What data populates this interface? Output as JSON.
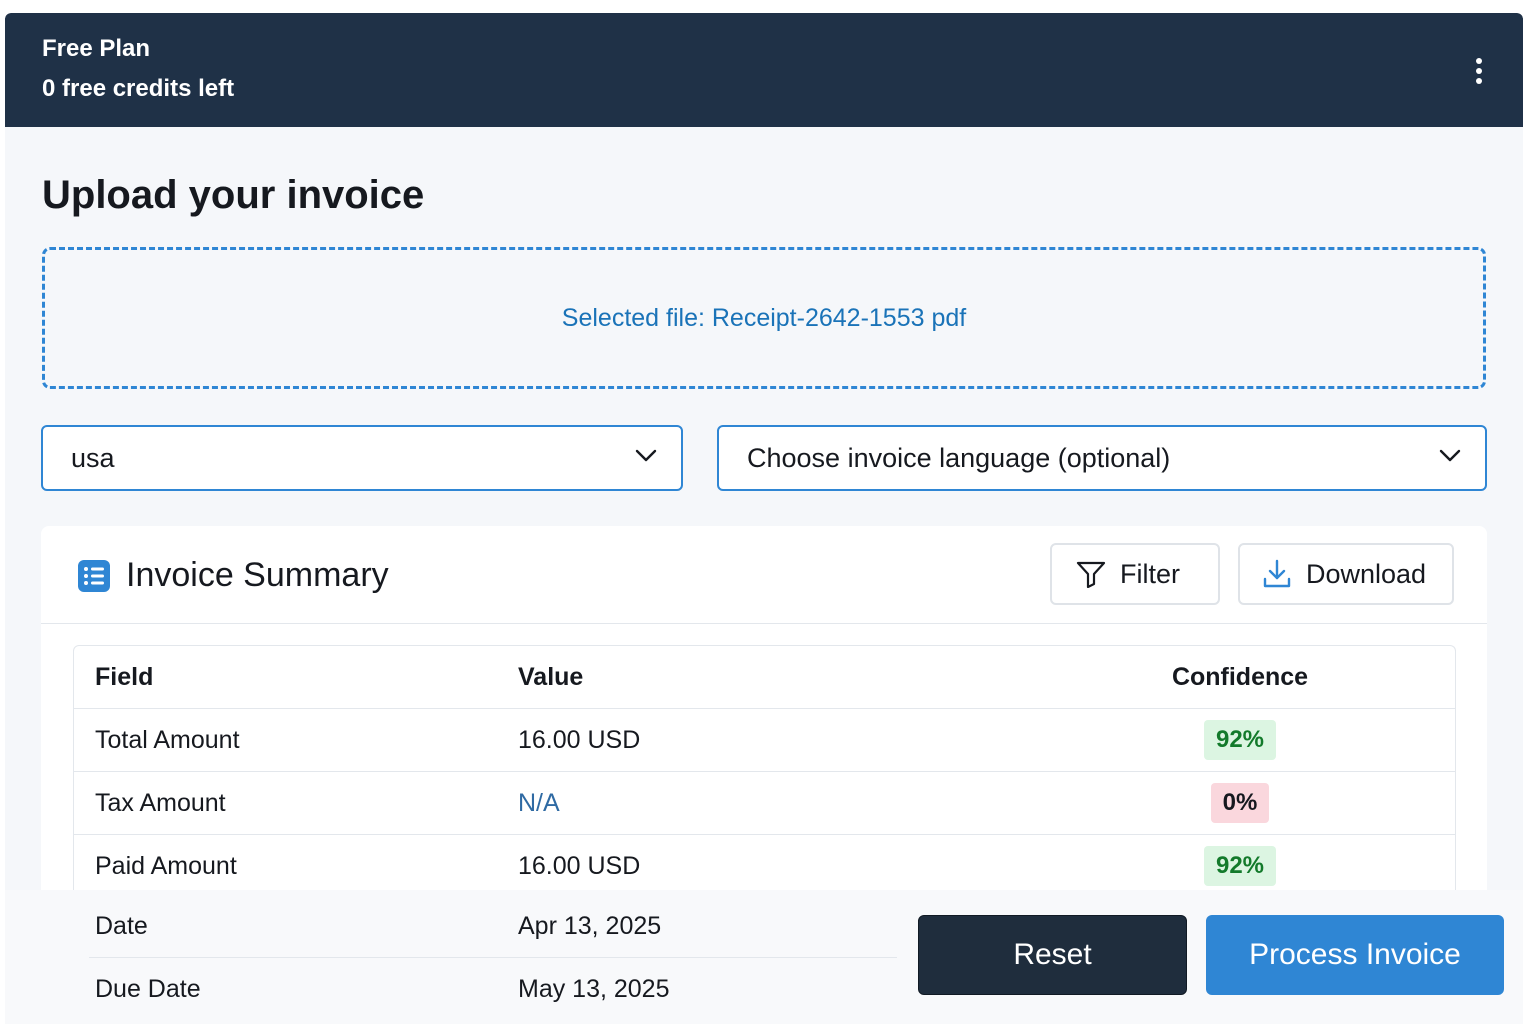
{
  "header": {
    "plan_name": "Free Plan",
    "credits_text": "0 free credits left",
    "menu_icon": "more-vertical-icon"
  },
  "page": {
    "title": "Upload your invoice"
  },
  "upload": {
    "selected_file_text": "Selected file: Receipt-2642-1553 pdf"
  },
  "selects": {
    "country_value": "usa",
    "language_placeholder": "Choose invoice language (optional)",
    "chevron_icon": "chevron-down-icon"
  },
  "summary": {
    "title": "Invoice Summary",
    "icon": "list-icon",
    "filter_label": "Filter",
    "filter_icon": "filter-icon",
    "download_label": "Download",
    "download_icon": "download-icon",
    "columns": [
      "Field",
      "Value",
      "Confidence"
    ],
    "rows": [
      {
        "field": "Total Amount",
        "value": "16.00 USD",
        "confidence": "92%"
      },
      {
        "field": "Tax Amount",
        "value": "N/A",
        "confidence": "0%"
      },
      {
        "field": "Paid Amount",
        "value": "16.00 USD",
        "confidence": "92%"
      },
      {
        "field": "Date",
        "value": "Apr 13, 2025"
      },
      {
        "field": "Due Date",
        "value": "May 13, 2025"
      }
    ]
  },
  "actions": {
    "reset_label": "Reset",
    "process_label": "Process Invoice"
  },
  "colors": {
    "header_bg": "#1f3147",
    "accent": "#2f86d4",
    "good_badge": "#dcf5e2",
    "bad_badge": "#fad7dd"
  }
}
